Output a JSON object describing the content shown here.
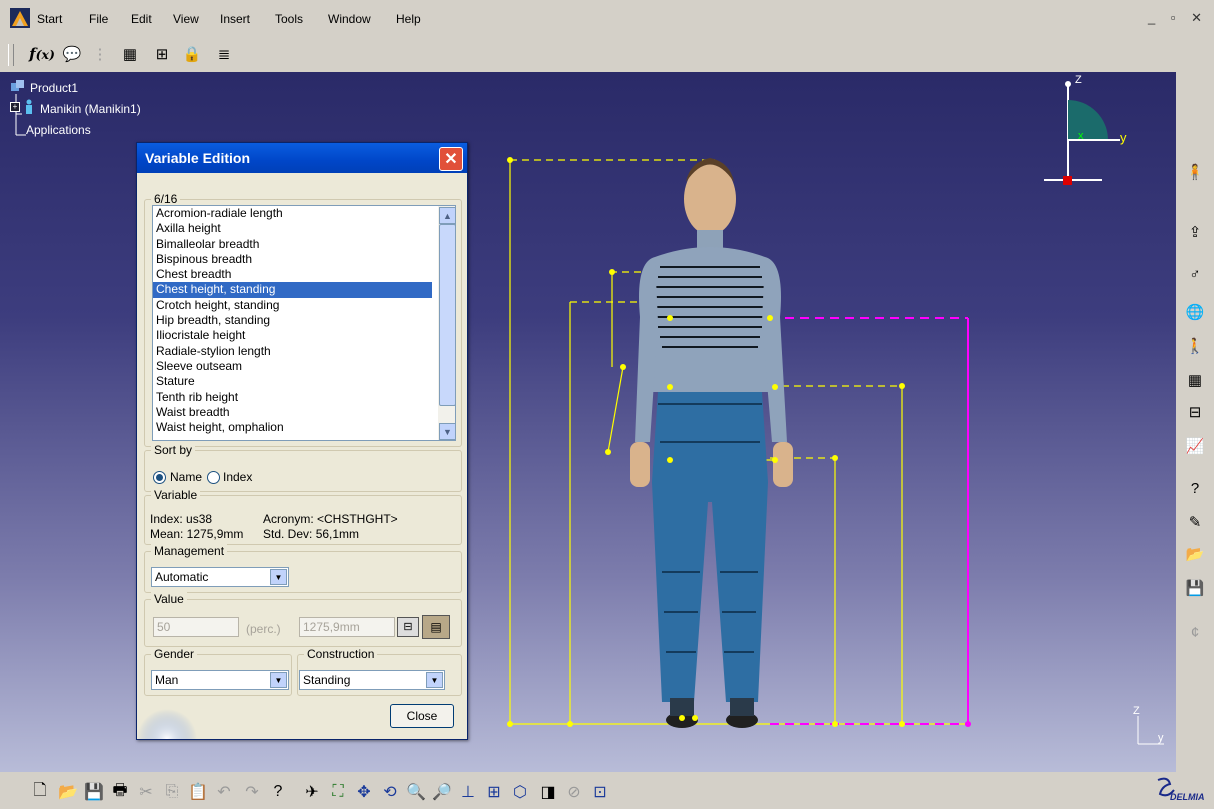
{
  "menu": {
    "start": "Start",
    "file": "File",
    "edit": "Edit",
    "view": "View",
    "insert": "Insert",
    "tools": "Tools",
    "window": "Window",
    "help": "Help"
  },
  "window_controls": "_ ▫ ✕",
  "tree": {
    "root": "Product1",
    "child": "Manikin (Manikin1)",
    "apps": "Applications"
  },
  "dialog": {
    "title": "Variable Edition",
    "list_group": "6/16",
    "list_items": [
      "Acromion-radiale length",
      "Axilla height",
      "Bimalleolar breadth",
      "Bispinous breadth",
      "Chest breadth",
      "Chest height, standing",
      "Crotch height, standing",
      "Hip breadth, standing",
      "Iliocristale height",
      "Radiale-stylion length",
      "Sleeve outseam",
      "Stature",
      "Tenth rib height",
      "Waist breadth",
      "Waist height, omphalion"
    ],
    "selected_index": 5,
    "sort_by": {
      "label": "Sort by",
      "name": "Name",
      "index": "Index",
      "selected": "Name"
    },
    "variable": {
      "label": "Variable",
      "index_text": "Index: us38",
      "acronym_text": "Acronym: <CHSTHGHT>",
      "mean_text": "Mean: 1275,9mm",
      "stddev_text": "Std. Dev: 56,1mm"
    },
    "management": {
      "label": "Management",
      "value": "Automatic"
    },
    "value": {
      "label": "Value",
      "percent": "50",
      "perc_label": "(perc.)",
      "mm": "1275,9mm"
    },
    "gender": {
      "label": "Gender",
      "value": "Man"
    },
    "construction": {
      "label": "Construction",
      "value": "Standing"
    },
    "close_label": "Close"
  },
  "axis": {
    "z": "Z",
    "y": "y",
    "x": "x",
    "z_small": "Z",
    "y_small": "y"
  },
  "brand": "DELMIA",
  "colors": {
    "accent_magenta": "#ff00ff",
    "measure_yellow": "#ffff00",
    "selection_blue": "#316ac5"
  }
}
